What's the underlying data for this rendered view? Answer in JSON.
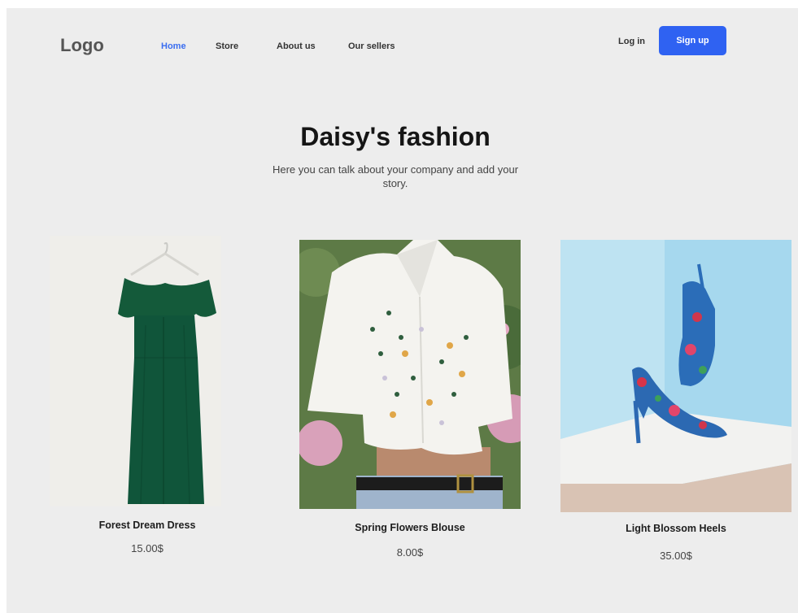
{
  "nav": {
    "logo": "Logo",
    "links": [
      {
        "label": "Home",
        "active": true
      },
      {
        "label": "Store",
        "active": false
      },
      {
        "label": "About us",
        "active": false
      },
      {
        "label": "Our sellers",
        "active": false
      }
    ],
    "login_label": "Log in",
    "signup_label": "Sign up"
  },
  "hero": {
    "title": "Daisy's fashion",
    "description": "Here you can talk about your company and add your story."
  },
  "products": [
    {
      "name": "Forest Dream Dress",
      "price": "15.00$",
      "image": "green-dress-image"
    },
    {
      "name": "Spring Flowers Blouse",
      "price": "8.00$",
      "image": "floral-blouse-image"
    },
    {
      "name": "Light Blossom Heels",
      "price": "35.00$",
      "image": "blue-floral-heels-image"
    }
  ],
  "colors": {
    "background": "#ededed",
    "accent": "#2f62f2",
    "active_link": "#3a6df0",
    "text": "#151515"
  }
}
